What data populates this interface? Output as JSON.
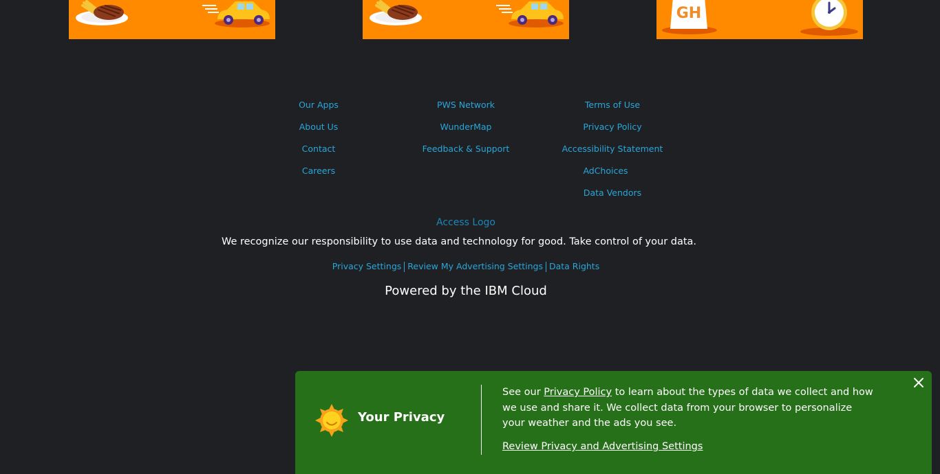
{
  "footer": {
    "col1": [
      "Our Apps",
      "About Us",
      "Contact",
      "Careers"
    ],
    "col2": [
      "PWS Network",
      "WunderMap",
      "Feedback & Support"
    ],
    "col3": [
      "Terms of Use",
      "Privacy Policy",
      "Accessibility Statement",
      "AdChoices",
      "Data Vendors"
    ],
    "access_logo": "Access Logo",
    "tagline": "We recognize our responsibility to use data and technology for good. Take control of your data.",
    "privacy_links": [
      "Privacy Settings",
      "Review My Advertising Settings",
      "Data Rights"
    ],
    "powered_by": "Powered by the IBM Cloud"
  },
  "privacy_banner": {
    "title": "Your Privacy",
    "text_before": "See our ",
    "policy_link": "Privacy Policy",
    "text_after": " to learn about the types of data we collect and how we use and share it. We collect data from your browser to personalize your weather and the ads you see.",
    "review_link": "Review Privacy and Advertising Settings",
    "close_icon": "close-icon",
    "sun_icon": "sun-icon",
    "color": "#267019"
  },
  "promos": [
    {
      "icons": [
        "steak-plate-icon",
        "delivery-car-icon"
      ],
      "color": "#ff8a00"
    },
    {
      "icons": [
        "steak-plate-icon",
        "delivery-car-icon"
      ],
      "color": "#ff8a00"
    },
    {
      "icons": [
        "grubhub-bag-icon",
        "alarm-clock-icon"
      ],
      "color": "#ff8a00"
    }
  ]
}
